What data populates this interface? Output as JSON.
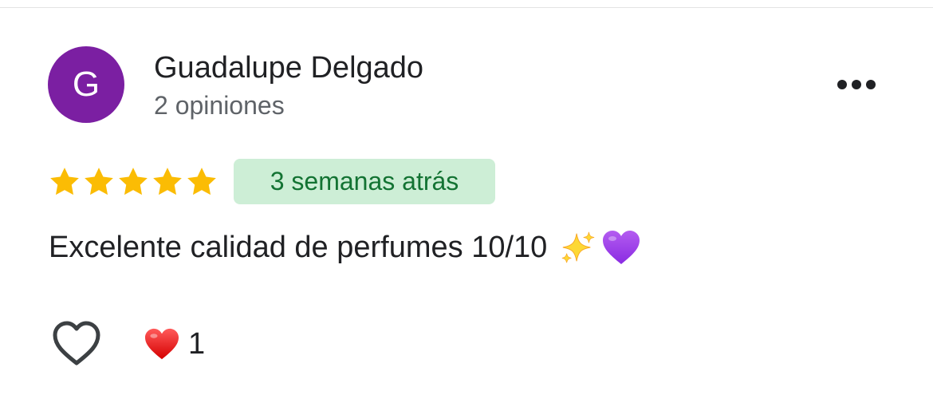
{
  "reviewer": {
    "avatar_initial": "G",
    "avatar_color": "#7b1fa2",
    "name": "Guadalupe Delgado",
    "review_count": "2 opiniones"
  },
  "menu": {
    "icon": "more-horizontal-icon"
  },
  "rating": {
    "stars": 5,
    "max_stars": 5,
    "star_color": "#fbbc04"
  },
  "date": {
    "label": "3 semanas atrás",
    "badge_bg": "#cdeed6",
    "badge_text_color": "#137333"
  },
  "review": {
    "text": "Excelente calidad de perfumes 10/10",
    "emojis": [
      "sparkles-icon",
      "purple-heart-icon"
    ]
  },
  "actions": {
    "like_icon": "heart-outline-icon",
    "reaction_icon": "red-heart-icon",
    "reaction_count": "1"
  }
}
